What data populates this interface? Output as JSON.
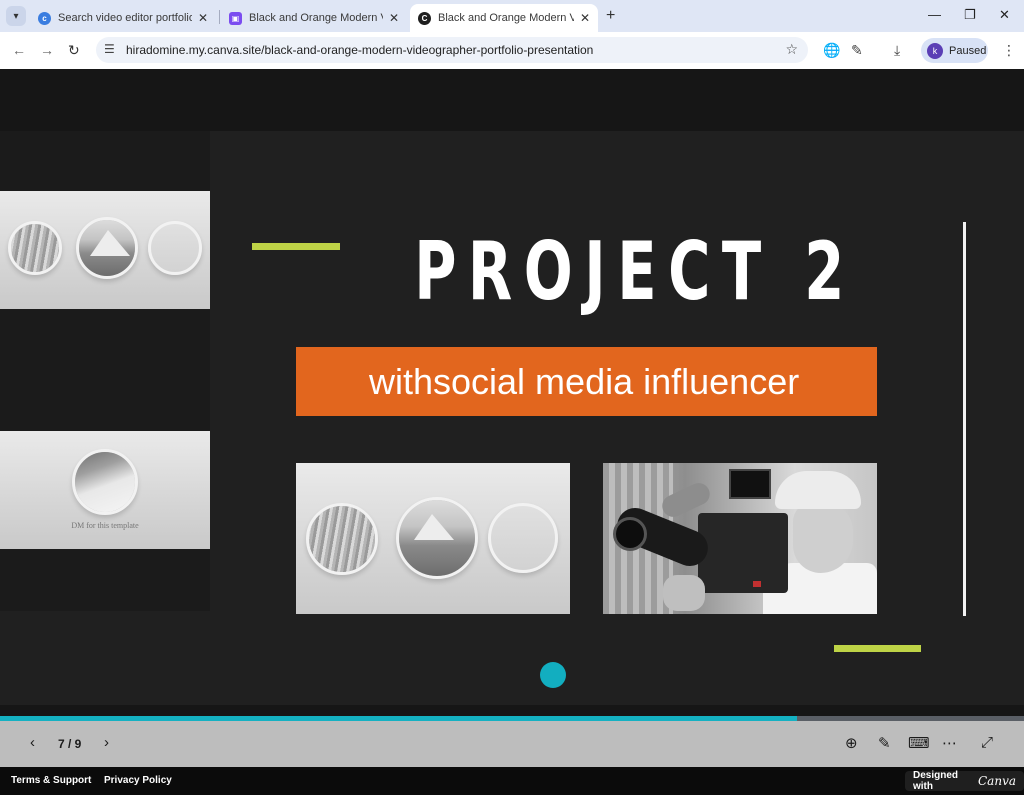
{
  "browser": {
    "tabs": [
      {
        "title": "Search video editor portfolio - C",
        "favicon_color": "#3a7de0",
        "active": false
      },
      {
        "title": "Black and Orange Modern Video",
        "favicon_color": "#7b4cf0",
        "active": false
      },
      {
        "title": "Black and Orange Modern Video",
        "favicon_color": "#1f1f1f",
        "active": true
      }
    ],
    "url": "hiradomine.my.canva.site/black-and-orange-modern-videographer-portfolio-presentation",
    "profile_initial": "k",
    "profile_status": "Paused"
  },
  "slide": {
    "title": "PROJECT 2",
    "subtitle": "withsocial media influencer",
    "thumb_caption": "DM for this template",
    "colors": {
      "accent_green": "#bed346",
      "orange": "#e2661e",
      "teal": "#12aec0"
    }
  },
  "viewer": {
    "page_indicator": "7 / 9",
    "progress_fraction": 0.778
  },
  "footer": {
    "terms": "Terms & Support",
    "privacy": "Privacy Policy",
    "designed_with": "Designed with",
    "brand": "Canva"
  }
}
